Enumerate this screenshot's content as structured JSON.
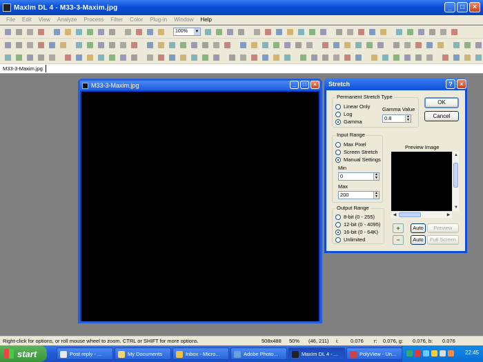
{
  "app": {
    "title": "MaxIm DL 4 - M33-3-Maxim.jpg",
    "window_buttons": {
      "minimize": "_",
      "maximize": "□",
      "close": "×"
    }
  },
  "menu": [
    {
      "label": "File",
      "active": false
    },
    {
      "label": "Edit",
      "active": false
    },
    {
      "label": "View",
      "active": false
    },
    {
      "label": "Analyze",
      "active": false
    },
    {
      "label": "Process",
      "active": false
    },
    {
      "label": "Filter",
      "active": false
    },
    {
      "label": "Color",
      "active": false
    },
    {
      "label": "Plug-in",
      "active": false
    },
    {
      "label": "Window",
      "active": false
    },
    {
      "label": "Help",
      "active": true
    }
  ],
  "toolbar": {
    "zoom_value": "100%",
    "zoom_arrow": "▼"
  },
  "document_tab": "M33-3-Maxim.jpg",
  "image_window": {
    "title": "M33-3-Maxim.jpg"
  },
  "stretch_dialog": {
    "title": "Stretch",
    "help_button": "?",
    "close_button": "×",
    "permanent_stretch": {
      "label": "Permanent Stretch Type",
      "options": [
        "Linear Only",
        "Log",
        "Gamma"
      ],
      "selected": "Gamma",
      "gamma_label": "Gamma Value",
      "gamma_value": "0.8"
    },
    "input_range": {
      "label": "Input Range",
      "options": [
        "Max Pixel",
        "Screen Stretch",
        "Manual Settings"
      ],
      "selected": "Manual Settings",
      "min_label": "Min",
      "min_value": "0",
      "max_label": "Max",
      "max_value": "200"
    },
    "output_range": {
      "label": "Output Range",
      "options": [
        "8-bit (0 - 255)",
        "12-bit (0 - 4095)",
        "16-bit (0 - 64K)",
        "Unlimited"
      ],
      "selected": "16-bit (0 - 64K)"
    },
    "preview_label": "Preview Image",
    "ok_label": "OK",
    "cancel_label": "Cancel",
    "auto_label_1": "Auto",
    "auto_label_2": "Auto",
    "preview_button": "Preview",
    "full_screen_button": "Full Screen",
    "zoom_in": "+",
    "zoom_out": "−"
  },
  "status": {
    "hint": "Right-click for options, or roll mouse wheel to zoom. CTRL or SHIFT for more options.",
    "dimensions": "508x488",
    "zoom": "50%",
    "coords": "(46, 211)",
    "i_label": "i:",
    "i_value": "0.076",
    "r_label": "r:",
    "rgb_value": "0.076, g:",
    "g_value": "0.076, b:",
    "b_value": "0.076"
  },
  "taskbar": {
    "start_label": "start",
    "tasks": [
      {
        "label": "Post reply - ...",
        "icon_color": "#e8e8e8",
        "active": false
      },
      {
        "label": "My Documents",
        "icon_color": "#f3d56a",
        "active": false
      },
      {
        "label": "Inbox - Micro...",
        "icon_color": "#f0c040",
        "active": false
      },
      {
        "label": "Adobe Photo...",
        "icon_color": "#6aa0d8",
        "active": false
      },
      {
        "label": "MaxIm DL 4 - ...",
        "icon_color": "#222222",
        "active": true
      },
      {
        "label": "PolyView - Un...",
        "icon_color": "#d04040",
        "active": false
      }
    ],
    "clock": "22:45"
  }
}
